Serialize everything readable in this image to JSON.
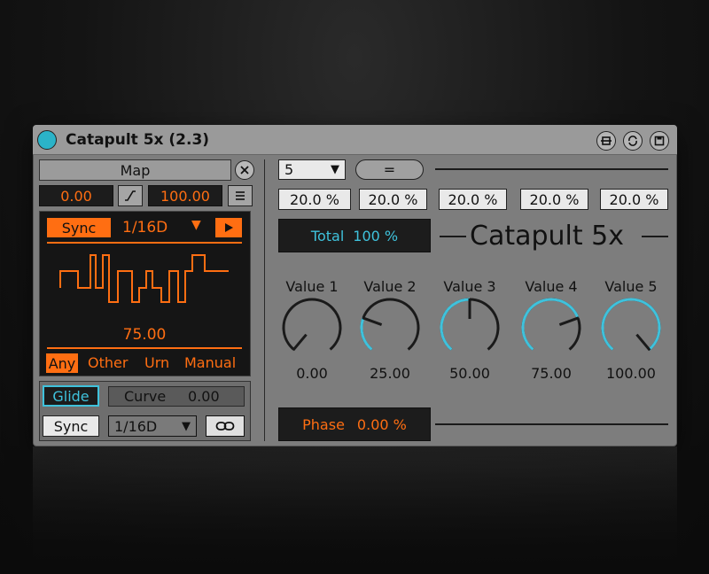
{
  "device": {
    "title": "Catapult 5x (2.3)",
    "power_color": "#2bb3c8",
    "title_buttons": [
      "fold-icon",
      "hotswap-icon",
      "save-icon"
    ]
  },
  "left": {
    "map_label": "Map",
    "range_min": "0.00",
    "range_max": "100.00",
    "rand": {
      "sync_label": "Sync",
      "rate": "1/16D",
      "value": "75.00",
      "modes": [
        "Any",
        "Other",
        "Urn",
        "Manual"
      ],
      "active_mode": "Any"
    },
    "glide_label": "Glide",
    "curve_label": "Curve",
    "curve_value": "0.00",
    "sync2_label": "Sync",
    "rate2": "1/16D"
  },
  "right": {
    "count_value": "5",
    "equal_label": "=",
    "percents": [
      "20.0 %",
      "20.0 %",
      "20.0 %",
      "20.0 %",
      "20.0 %"
    ],
    "total_label": "Total",
    "total_value": "100 %",
    "brand": "Catapult 5x",
    "knobs": [
      {
        "label": "Value 1",
        "value": "0.00",
        "level": 0
      },
      {
        "label": "Value 2",
        "value": "25.00",
        "level": 0.25
      },
      {
        "label": "Value 3",
        "value": "50.00",
        "level": 0.5
      },
      {
        "label": "Value 4",
        "value": "75.00",
        "level": 0.75
      },
      {
        "label": "Value 5",
        "value": "100.00",
        "level": 1
      }
    ],
    "phase_label": "Phase",
    "phase_value": "0.00 %"
  },
  "colors": {
    "accent_orange": "#ff6e12",
    "accent_cyan": "#3fc2dc",
    "panel_dark": "#151515"
  }
}
